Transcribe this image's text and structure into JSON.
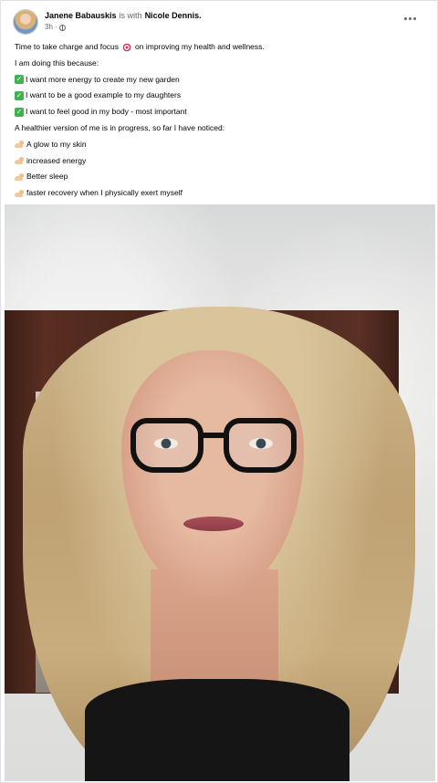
{
  "post": {
    "author": "Janene Babauskis",
    "with_text": "is with",
    "tagged": "Nicole Dennis.",
    "time": "3h",
    "audience_icon": "globe-icon",
    "lines": [
      {
        "type": "text-target",
        "before": "Time to take charge and focus",
        "after": "on improving my health and wellness."
      },
      {
        "type": "text",
        "text": "I am doing this because:"
      },
      {
        "type": "check",
        "text": "I want more energy to create my new garden"
      },
      {
        "type": "check",
        "text": "I want to be a good example to my daughters"
      },
      {
        "type": "check",
        "text": "I want to feel good in my body - most important"
      },
      {
        "type": "text",
        "text": "A healthier version of me is in progress, so far I have noticed:"
      },
      {
        "type": "muscle",
        "text": "A glow to my skin"
      },
      {
        "type": "muscle",
        "text": "increased energy"
      },
      {
        "type": "muscle",
        "text": "Better sleep"
      },
      {
        "type": "muscle",
        "text": " faster recovery when I physically exert myself"
      }
    ]
  },
  "colors": {
    "name": "#050505",
    "secondary": "#65676b",
    "check": "#3fb34f"
  }
}
